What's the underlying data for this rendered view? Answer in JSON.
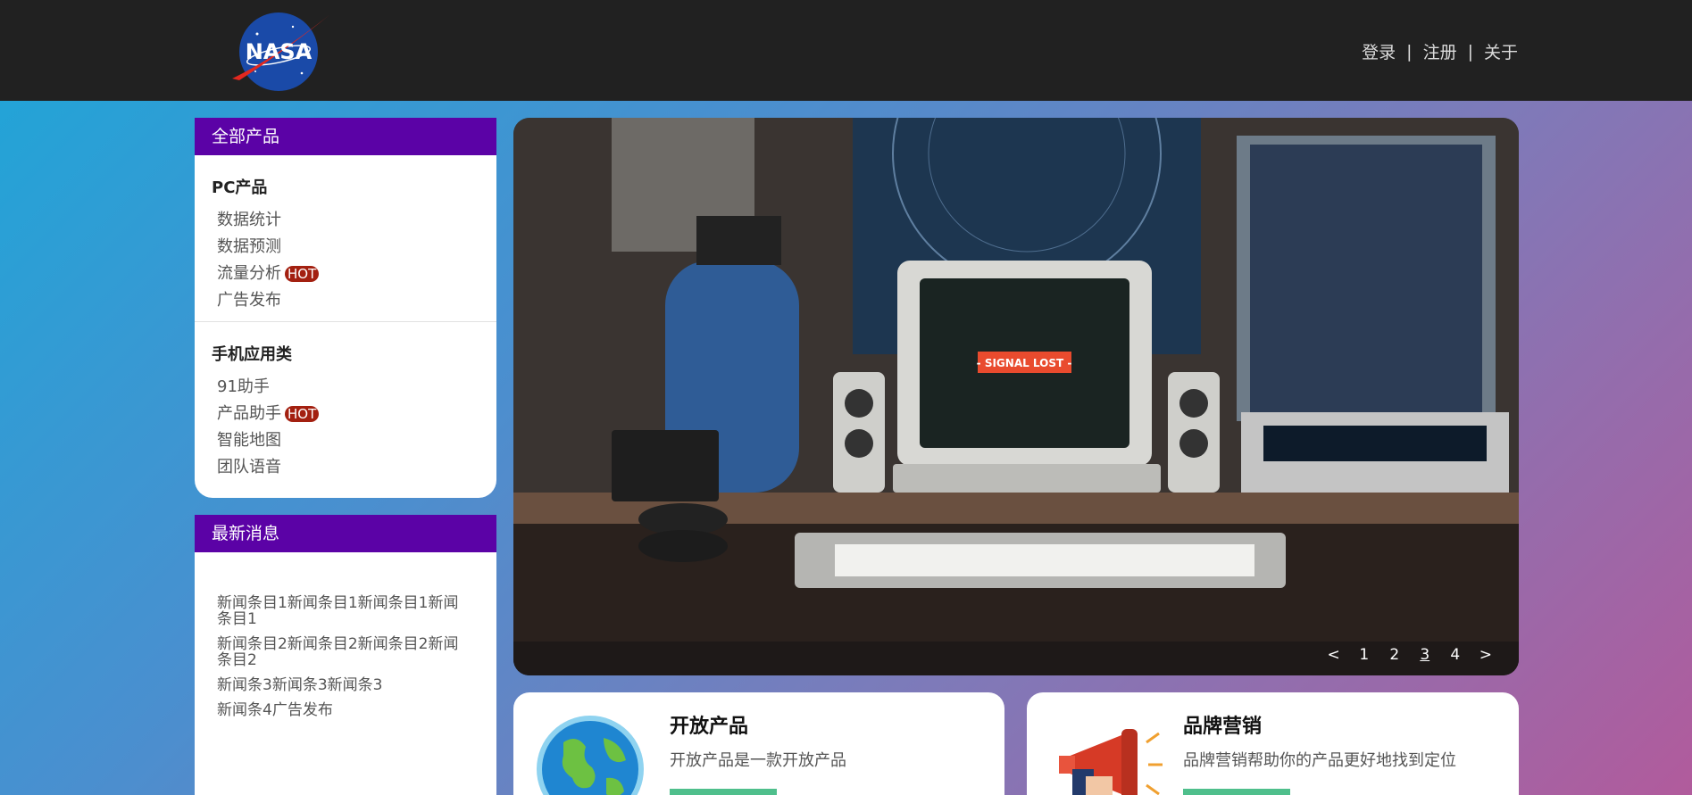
{
  "header": {
    "logo_text": "NASA",
    "links": [
      {
        "label": "登录"
      },
      {
        "label": "注册"
      },
      {
        "label": "关于"
      }
    ],
    "separator": "|"
  },
  "products_panel": {
    "title": "全部产品",
    "groups": [
      {
        "title": "PC产品",
        "items": [
          {
            "label": "数据统计",
            "badge": ""
          },
          {
            "label": "数据预测",
            "badge": ""
          },
          {
            "label": "流量分析",
            "badge": "HOT"
          },
          {
            "label": "广告发布",
            "badge": ""
          }
        ]
      },
      {
        "title": "手机应用类",
        "items": [
          {
            "label": "91助手",
            "badge": ""
          },
          {
            "label": "产品助手",
            "badge": "HOT"
          },
          {
            "label": "智能地图",
            "badge": ""
          },
          {
            "label": "团队语音",
            "badge": ""
          }
        ]
      }
    ]
  },
  "news_panel": {
    "title": "最新消息",
    "items": [
      "新闻条目1新闻条目1新闻条目1新闻条目1",
      "新闻条目2新闻条目2新闻条目2新闻条目2",
      "新闻条3新闻条3新闻条3",
      "新闻条4广告发布"
    ]
  },
  "carousel": {
    "screen_text": "- SIGNAL LOST -",
    "prev": "<",
    "next": ">",
    "pages": [
      "1",
      "2",
      "3",
      "4"
    ],
    "active_page": "3"
  },
  "cards": [
    {
      "title": "开放产品",
      "desc": "开放产品是一款开放产品",
      "icon": "globe-icon"
    },
    {
      "title": "品牌营销",
      "desc": "品牌营销帮助你的产品更好地找到定位",
      "icon": "megaphone-icon"
    }
  ],
  "colors": {
    "header_bg": "#212121",
    "panel_head": "#5b02a6",
    "hot_badge": "#a32010",
    "card_button": "#4fbf8c"
  }
}
